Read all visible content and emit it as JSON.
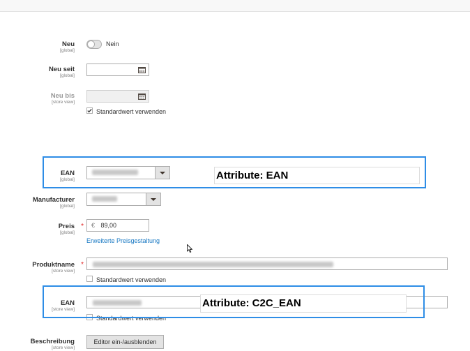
{
  "fields": {
    "neu": {
      "label": "Neu",
      "scope": "[global]",
      "toggle_value": "Nein"
    },
    "neu_seit": {
      "label": "Neu seit",
      "scope": "[global]"
    },
    "neu_bis": {
      "label": "Neu bis",
      "scope": "[store view]",
      "checkbox_label": "Standardwert verwenden"
    },
    "ean_global": {
      "label": "EAN",
      "scope": "[global]"
    },
    "manufacturer": {
      "label": "Manufacturer",
      "scope": "[global]"
    },
    "preis": {
      "label": "Preis",
      "scope": "[global]",
      "currency": "€",
      "value": "89,00",
      "link": "Erweiterte Preisgestaltung"
    },
    "produktname": {
      "label": "Produktname",
      "scope": "[store view]",
      "checkbox_label": "Standardwert verwenden"
    },
    "ean_store": {
      "label": "EAN",
      "scope": "[store view]",
      "checkbox_label": "Standardwert verwenden"
    },
    "beschreibung": {
      "label": "Beschreibung",
      "scope": "[store view]",
      "button": "Editor ein-/ausblenden"
    }
  },
  "annotations": {
    "ean": "Attribute: EAN",
    "c2c_ean": "Attribute: C2C_EAN"
  },
  "colors": {
    "highlight": "#2e8de6",
    "link": "#1979c3",
    "required": "#e22626"
  }
}
